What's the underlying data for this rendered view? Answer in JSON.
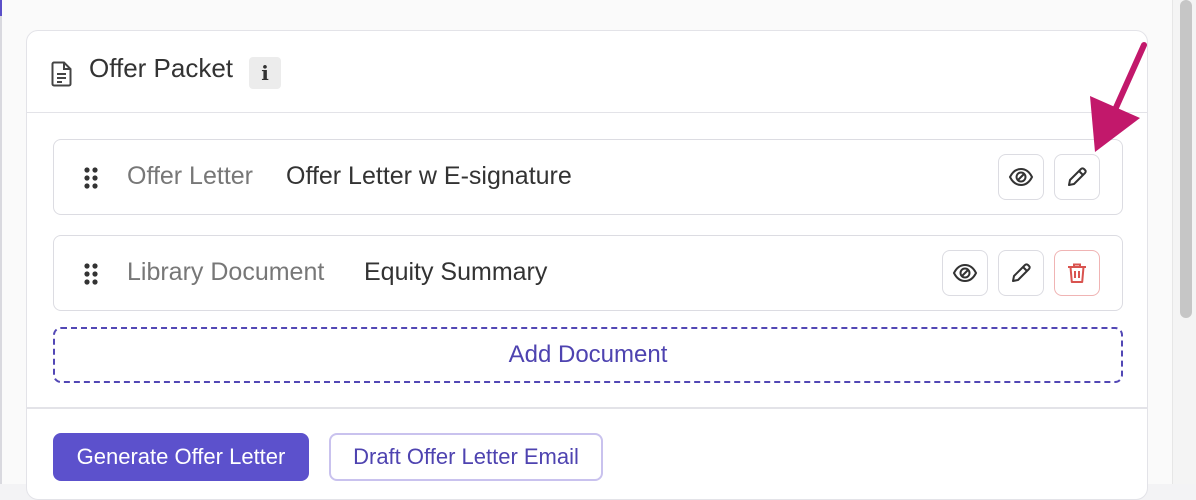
{
  "card": {
    "title": "Offer Packet",
    "info_badge": "i",
    "title_icon": "document-icon"
  },
  "documents": [
    {
      "type": "Offer Letter",
      "name": "Offer Letter w E-signature",
      "actions": [
        "preview-icon",
        "edit-icon"
      ]
    },
    {
      "type": "Library Document",
      "name": "Equity Summary",
      "actions": [
        "preview-icon",
        "edit-icon",
        "delete-icon"
      ]
    }
  ],
  "add_document_label": "Add Document",
  "footer": {
    "primary_button": "Generate Offer Letter",
    "secondary_button": "Draft Offer Letter Email"
  },
  "colors": {
    "accent": "#5c51cc",
    "accent_text": "#4e43b0",
    "danger": "#d9534f",
    "annotation_arrow": "#c2186b"
  }
}
